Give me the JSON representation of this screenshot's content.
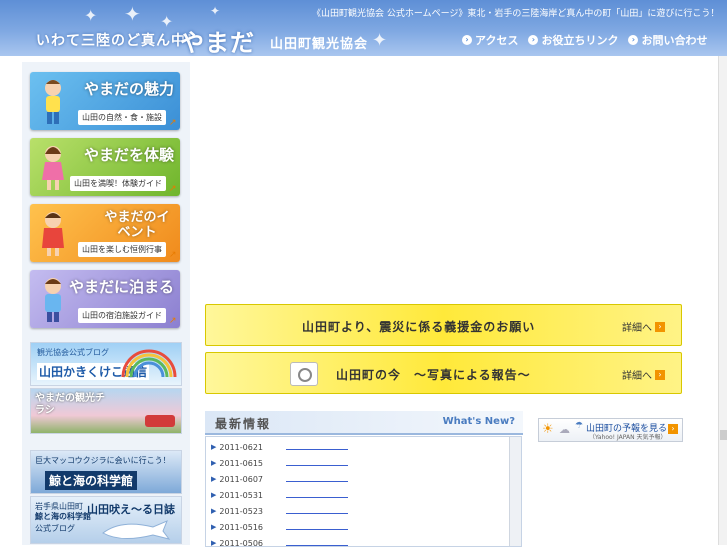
{
  "header": {
    "tagline": "いわて三陸のど真ん中！",
    "logo": "やまだ",
    "org": "山田町観光協会",
    "topline": "《山田町観光協会 公式ホームページ》東北・岩手の三陸海岸ど真ん中の町「山田」に遊びに行こう！",
    "nav": [
      {
        "label": "アクセス"
      },
      {
        "label": "お役立ちリンク"
      },
      {
        "label": "お問い合わせ"
      }
    ]
  },
  "menu": [
    {
      "title": "やまだの魅力",
      "sub": "山田の自然・食・施設",
      "color": "#5aa8e0"
    },
    {
      "title": "やまだを体験",
      "sub": "山田を満喫！体験ガイド",
      "color": "#8cc63f"
    },
    {
      "title": "やまだのイベント",
      "sub": "山田を楽しむ恒例行事",
      "color": "#f4a020"
    },
    {
      "title": "やまだに泊まる",
      "sub": "山田の宿泊施設ガイド",
      "color": "#9b8fd6"
    }
  ],
  "banners": {
    "blog_small": "観光協会公式ブログ",
    "blog_big": "山田かきくけこ通信",
    "chirashi": "やまだの観光チラシ",
    "kujira_small": "巨大マッコウクジラに会いに行こう！",
    "kujira_big": "鯨と海の科学館",
    "nikki_small": "岩手県山田町",
    "nikki_mid": "鯨と海の科学館",
    "nikki_title": "山田吠え～る日誌",
    "nikki_blog": "公式ブログ"
  },
  "notices": [
    {
      "text": "山田町より、震災に係る義援金のお願い",
      "link": "詳細へ"
    },
    {
      "text": "山田町の今　～写真による報告～",
      "link": "詳細へ"
    }
  ],
  "news": {
    "title": "最新情報",
    "whatsnew": "What's New?",
    "items": [
      "2011-0621",
      "2011-0615",
      "2011-0607",
      "2011-0531",
      "2011-0523",
      "2011-0516",
      "2011-0506"
    ]
  },
  "weather": {
    "label": "山田町の予報を見る",
    "source": "（Yahoo! JAPAN 天気予報）"
  }
}
